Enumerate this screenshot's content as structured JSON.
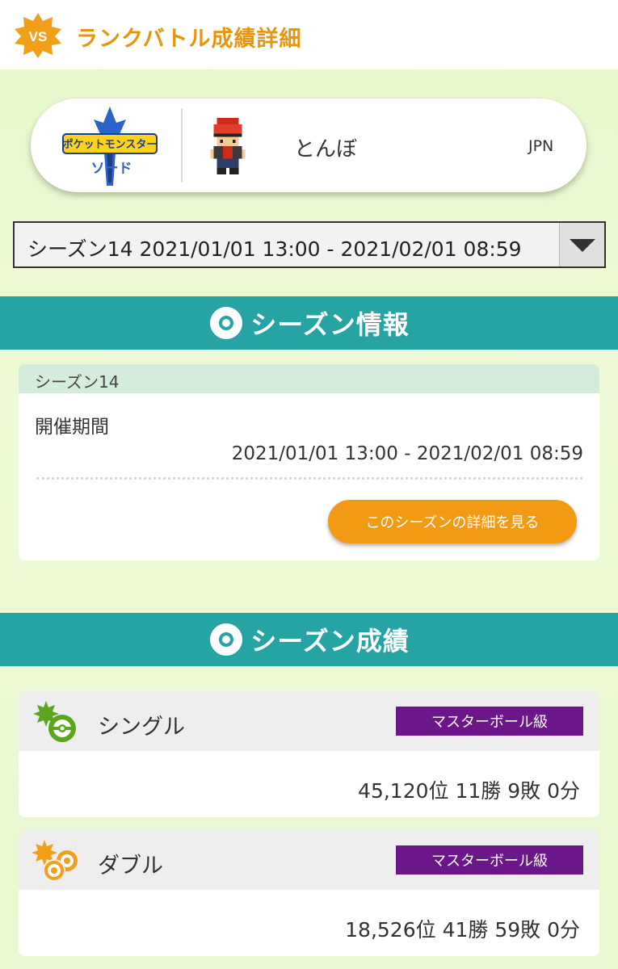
{
  "header": {
    "badge_text": "VS",
    "title": "ランクバトル成績詳細"
  },
  "profile": {
    "game_logo_text": "ポケットモンスター",
    "game_logo_subtext": "ソード",
    "player_name": "とんぼ",
    "region": "JPN"
  },
  "season_select": {
    "selected": "シーズン14 2021/01/01 13:00 - 2021/02/01 08:59"
  },
  "season_info": {
    "section_title": "シーズン情報",
    "season_label": "シーズン14",
    "period_label": "開催期間",
    "period_value": "2021/01/01 13:00 - 2021/02/01 08:59",
    "detail_button": "このシーズンの詳細を見る"
  },
  "season_results": {
    "section_title": "シーズン成績",
    "single": {
      "label": "シングル",
      "rank_badge": "マスターボール級",
      "record": "45,120位 11勝 9敗 0分"
    },
    "double": {
      "label": "ダブル",
      "rank_badge": "マスターボール級",
      "record": "18,526位 41勝 59敗 0分"
    }
  },
  "colors": {
    "accent_orange": "#e8940f",
    "teal_band": "#26a3a3",
    "master_ball_purple": "#6b178a",
    "button_orange": "#f29a14",
    "single_green": "#5aa61e",
    "double_orange": "#f2a01a"
  }
}
